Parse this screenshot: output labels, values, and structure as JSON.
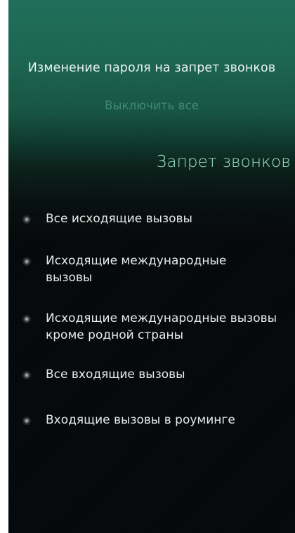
{
  "pulley_menu": {
    "change_password": "Изменение пароля на запрет звонков",
    "disable_all": "Выключить все"
  },
  "page": {
    "title": "Запрет звонков"
  },
  "options": [
    {
      "label": "Все исходящие вызовы"
    },
    {
      "label": "Исходящие международные вызовы"
    },
    {
      "label": "Исходящие международные вызовы кроме родной страны"
    },
    {
      "label": "Все входящие вызовы"
    },
    {
      "label": "Входящие вызовы в роуминге"
    }
  ],
  "icons": {
    "bullet": "radio-indicator-icon"
  },
  "colors": {
    "accent": "#9ee3c8",
    "header_gradient_top": "#1f6e59",
    "background": "#05080a",
    "dim_text": "#3f8a73"
  }
}
